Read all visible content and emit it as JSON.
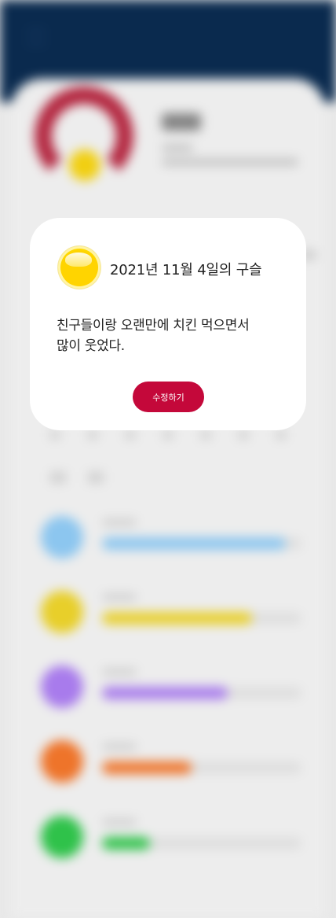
{
  "modal": {
    "date_title": "2021년 11월 4일의 구슬",
    "entry_text_line1": "친구들이랑 오랜만에 치킨 먹으면서",
    "entry_text_line2": "많이 웃었다.",
    "edit_button_label": "수정하기",
    "orb_color": "#ffd800",
    "edit_button_color": "#c4083a"
  },
  "background": {
    "header_color": "#0a2a4e",
    "donut_color": "#b3263f",
    "mood_rows": [
      {
        "color": "#8cc6ef",
        "level": 0.92
      },
      {
        "color": "#e8cf2a",
        "level": 0.75
      },
      {
        "color": "#a87bec",
        "level": 0.63
      },
      {
        "color": "#ee742a",
        "level": 0.45
      },
      {
        "color": "#2fc24a",
        "level": 0.24
      }
    ]
  }
}
